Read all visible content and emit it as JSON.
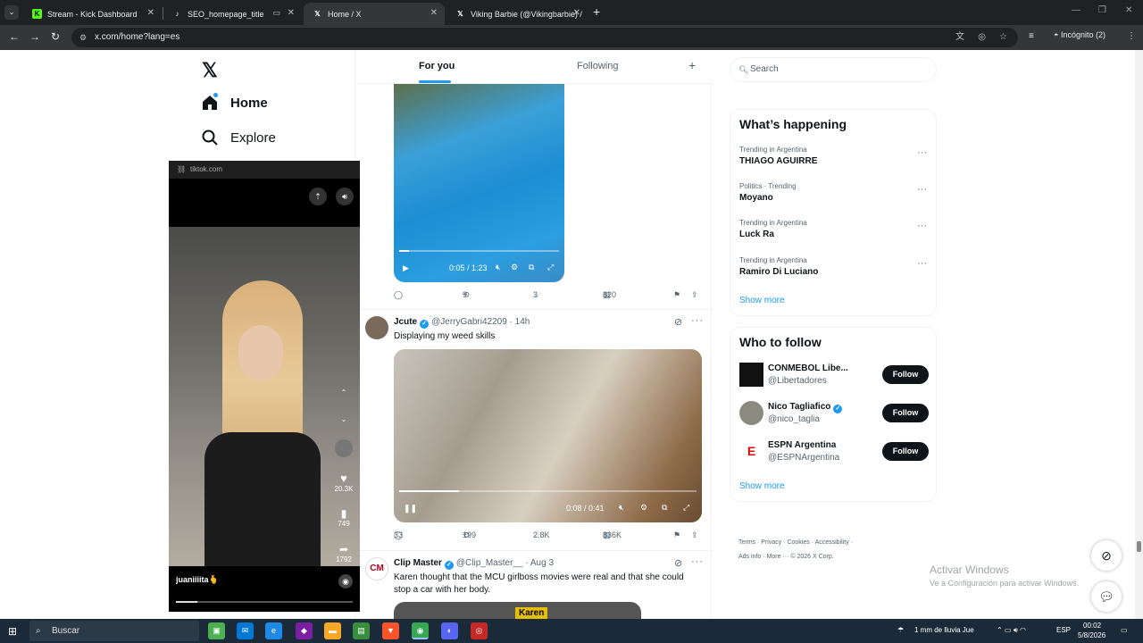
{
  "browser": {
    "tabs": [
      {
        "title": "Stream - Kick Dashboard",
        "icon": "kick-icon"
      },
      {
        "title": "SEO_homepage_title",
        "icon": "tiktok-icon"
      },
      {
        "title": "Home / X",
        "icon": "x-icon"
      },
      {
        "title": "Viking Barbie (@Vikingbarbie) /",
        "icon": "x-icon"
      }
    ],
    "url": "x.com/home?lang=es",
    "profile_label": "Incógnito (2)"
  },
  "sidebar": {
    "home_label": "Home",
    "explore_label": "Explore"
  },
  "tiktok_popup": {
    "domain": "tiktok.com",
    "likes": "20.3K",
    "saves": "749",
    "shares": "1792",
    "username": "juaniiiita🫰"
  },
  "timeline": {
    "tab_for_you": "For you",
    "tab_following": "Following",
    "tweet1": {
      "video_time": "0:05 / 1:23",
      "retweets": "9",
      "likes": "3",
      "views": "820"
    },
    "tweet2": {
      "name": "Jcute",
      "handle": "@JerryGabri42209",
      "time": "· 14h",
      "text": "Displaying my weed skills",
      "video_time": "0:08 / 0:41",
      "replies": "33",
      "retweets": "199",
      "likes": "2.8K",
      "views": "836K"
    },
    "tweet3": {
      "name": "Clip Master",
      "handle": "@Clip_Master__",
      "time": "· Aug 3",
      "text": "Karen thought that the MCU girlboss movies were real and that she could stop a car with her body.",
      "video_caption": "Karen"
    }
  },
  "right": {
    "search_placeholder": "Search",
    "trends_title": "What’s happening",
    "trends": [
      {
        "category": "Trending in Argentina",
        "name": "THIAGO AGUIRRE"
      },
      {
        "category": "Politics · Trending",
        "name": "Moyano"
      },
      {
        "category": "Trending in Argentina",
        "name": "Luck Ra"
      },
      {
        "category": "Trending in Argentina",
        "name": "Ramiro Di Luciano"
      }
    ],
    "show_more": "Show more",
    "who_title": "Who to follow",
    "follow": [
      {
        "name": "CONMEBOL Libe...",
        "handle": "@Libertadores",
        "button": "Follow"
      },
      {
        "name": "Nico Tagliafico",
        "handle": "@nico_taglia",
        "button": "Follow"
      },
      {
        "name": "ESPN Argentina",
        "handle": "@ESPNArgentina",
        "button": "Follow"
      }
    ],
    "show_more2": "Show more",
    "footer_line1": "Terms · Privacy · Cookies · Accessibility ·",
    "footer_line2": "Ads info · More ··· © 2026 X Corp."
  },
  "windows": {
    "activate_title": "Activar Windows",
    "activate_sub": "Ve a Configuración para activar Windows."
  },
  "taskbar": {
    "search_placeholder": "Buscar",
    "weather": "1 mm de lluvia Jue",
    "lang": "ESP",
    "time": "00:02",
    "date": "5/8/2026"
  }
}
